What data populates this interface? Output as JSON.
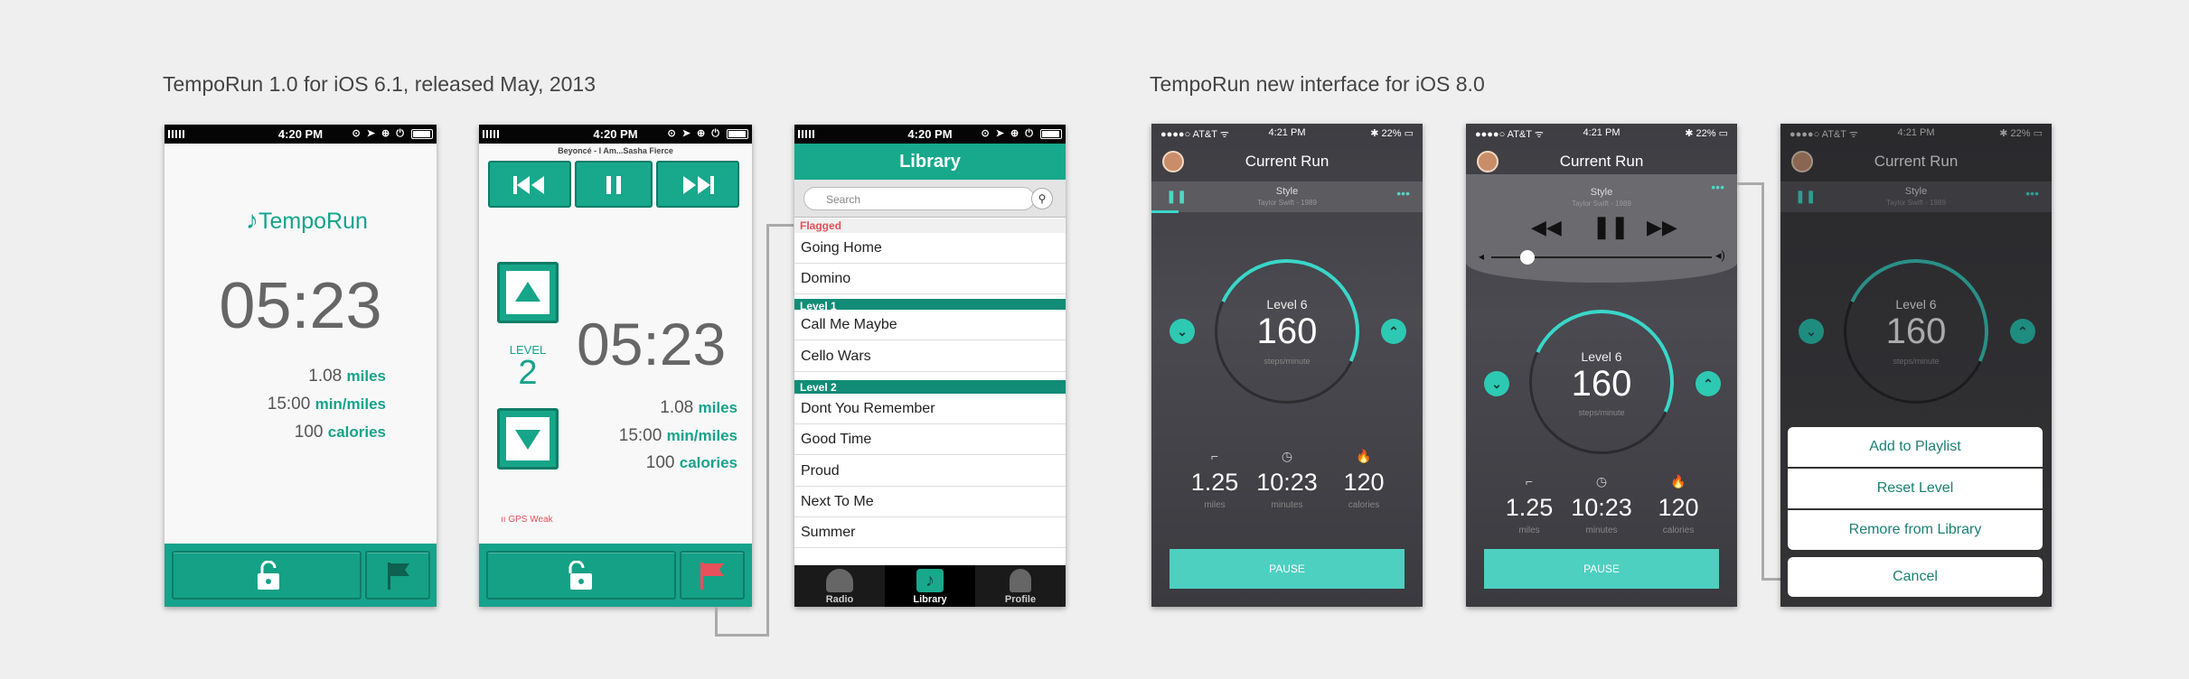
{
  "headings": {
    "left": "TempoRun 1.0 for iOS 6.1, released May, 2013",
    "right": "TempoRun new interface for iOS 8.0"
  },
  "old_statusbar": {
    "time": "4:20 PM",
    "icons": "⊙ ➤ ⊕ ⏻"
  },
  "screen1": {
    "logo": "TempoRun",
    "time": "05:23",
    "stats": [
      {
        "value": "1.08",
        "unit": "miles"
      },
      {
        "value": "15:00",
        "unit": "min/miles"
      },
      {
        "value": "100",
        "unit": "calories"
      }
    ],
    "lock_icon": "unlocked-lock-icon",
    "flag_icon": "flag-icon"
  },
  "screen2": {
    "song": "Beyoncé - I Am...Sasha Fierce",
    "level_label": "LEVEL",
    "level": "2",
    "time": "05:23",
    "stats": [
      {
        "value": "1.08",
        "unit": "miles"
      },
      {
        "value": "15:00",
        "unit": "min/miles"
      },
      {
        "value": "100",
        "unit": "calories"
      }
    ],
    "gps": "GPS Weak",
    "flag_color": "#e8505b"
  },
  "screen3": {
    "title": "Library",
    "search_placeholder": "Search",
    "flagged": "Flagged",
    "level1": "Level 1",
    "level2": "Level 2",
    "flagged_items": [
      "Going Home",
      "Domino"
    ],
    "level1_items": [
      "Call Me Maybe",
      "Cello Wars"
    ],
    "level2_items": [
      "Dont You Remember",
      "Good Time",
      "Proud",
      "Next To Me",
      "Summer"
    ],
    "tabs": [
      "Radio",
      "Library",
      "Profile"
    ]
  },
  "new_statusbar": {
    "carrier": "●●●●○ AT&T ᯤ",
    "time": "4:21 PM",
    "battery": "✱ 22% ▭"
  },
  "new_common": {
    "title": "Current Run",
    "style": "Style",
    "style_sub": "Taylor Swift - 1989",
    "level": "Level 6",
    "steps": "160",
    "steps_unit": "steps/minute",
    "metrics": [
      {
        "value": "1.25",
        "unit": "miles",
        "icon": "shoe-icon"
      },
      {
        "value": "10:23",
        "unit": "minutes",
        "icon": "clock-icon"
      },
      {
        "value": "120",
        "unit": "calories",
        "icon": "flame-icon"
      }
    ],
    "pause": "PAUSE"
  },
  "sheet": [
    "Add to Playlist",
    "Reset Level",
    "Remore from Library",
    "Cancel"
  ],
  "colors": {
    "teal_old": "#16a38b",
    "teal_new": "#4dd0c0",
    "flag_red": "#e8505b"
  }
}
